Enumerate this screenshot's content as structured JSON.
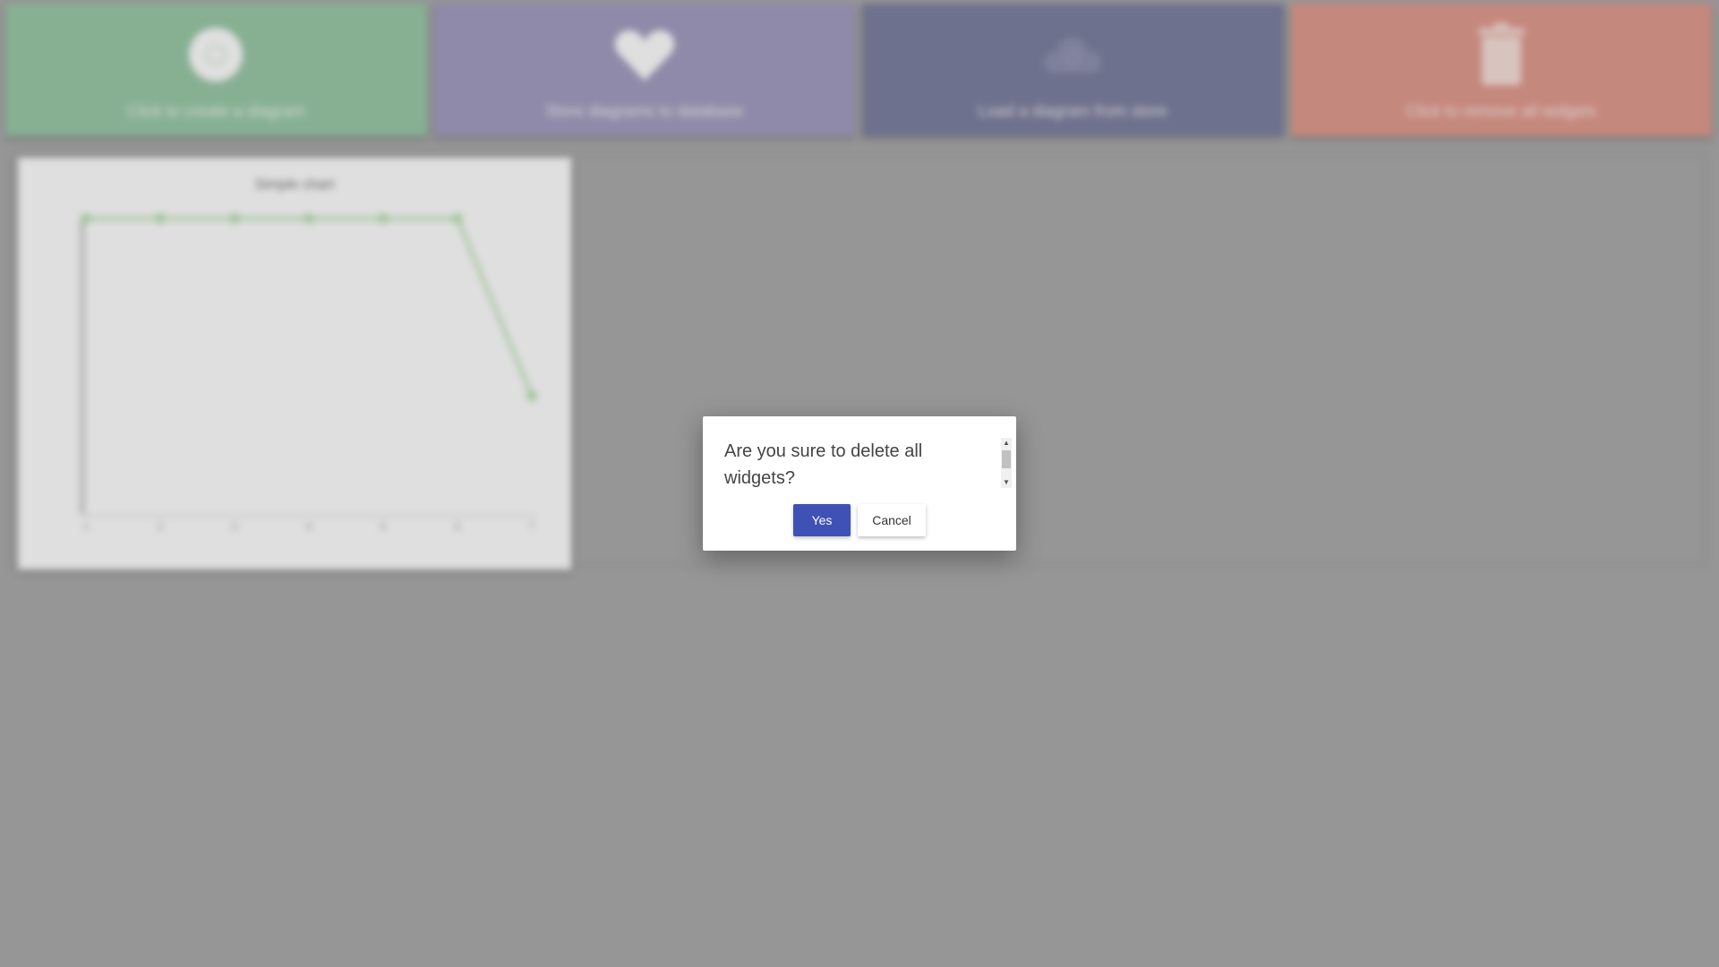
{
  "toolbar": {
    "tiles": [
      {
        "label": "Click to create a diagram",
        "icon": "plus-circle-icon",
        "color": "#94c6a3"
      },
      {
        "label": "Store diagrams to database",
        "icon": "heart-icon",
        "color": "#9e98bd"
      },
      {
        "label": "Load a diagram from store",
        "icon": "cloud-icon",
        "color": "#76799c"
      },
      {
        "label": "Click to remove all widgets",
        "icon": "trash-icon",
        "color": "#e09587"
      }
    ]
  },
  "widget": {
    "title": "Simple chart"
  },
  "chart_data": {
    "type": "line",
    "title": "Simple chart",
    "x": [
      "1",
      "2",
      "3",
      "4",
      "5",
      "6",
      "7"
    ],
    "series": [
      {
        "values": [
          10,
          10,
          10,
          10,
          10,
          10,
          4
        ]
      }
    ],
    "ylim": [
      0,
      10
    ],
    "color": "#b8e0b0"
  },
  "dialog": {
    "message": "Are you sure to delete all widgets?",
    "yes_label": "Yes",
    "cancel_label": "Cancel",
    "accent": "#3f51b5"
  }
}
